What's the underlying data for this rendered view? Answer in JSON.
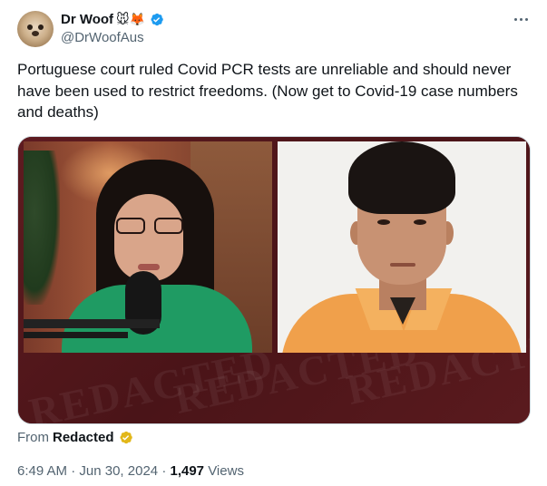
{
  "author": {
    "display_name": "Dr Woof",
    "name_emojis": "🐭🦊",
    "handle": "@DrWoofAus",
    "verified": true,
    "verified_color": "#1d9bf0"
  },
  "tweet": {
    "text": "Portuguese court ruled Covid PCR tests are unreliable and should never have been used to restrict freedoms. (Now get to Covid-19 case numbers and deaths)"
  },
  "media": {
    "watermark_text": "REDACTED",
    "brand_color": "#5a1a1e"
  },
  "source": {
    "prefix": "From",
    "name": "Redacted",
    "badge_color": "#e2b719"
  },
  "meta": {
    "time": "6:49 AM",
    "separator": "·",
    "date": "Jun 30, 2024",
    "views_count": "1,497",
    "views_label": "Views"
  },
  "icons": [
    "more-icon",
    "verified-badge-icon",
    "gold-check-badge-icon"
  ]
}
